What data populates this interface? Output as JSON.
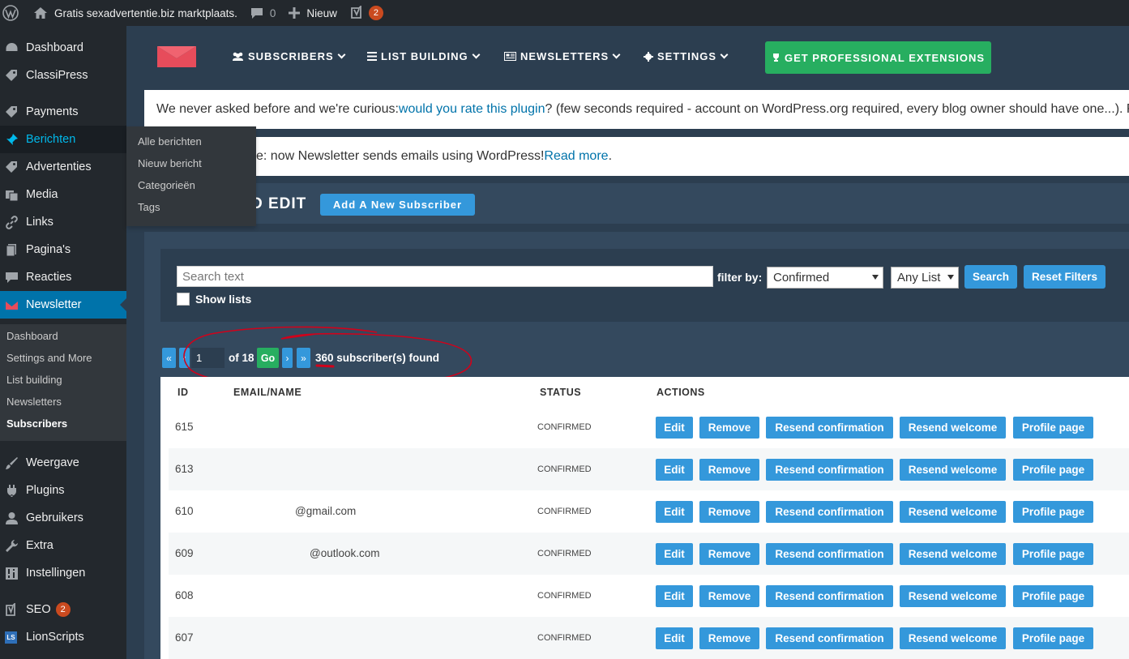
{
  "adminbar": {
    "site_name": "Gratis sexadvertentie.biz marktplaats.",
    "comments_count": "0",
    "new_label": "Nieuw",
    "seo_badge": "2"
  },
  "sidebar": {
    "items": [
      {
        "label": "Dashboard",
        "icon": "dashboard-icon"
      },
      {
        "label": "ClassiPress",
        "icon": "tag-icon"
      },
      {
        "label": "Payments",
        "icon": "tag-icon"
      },
      {
        "label": "Berichten",
        "icon": "pin-icon"
      },
      {
        "label": "Advertenties",
        "icon": "tag-icon"
      },
      {
        "label": "Media",
        "icon": "media-icon"
      },
      {
        "label": "Links",
        "icon": "link-icon"
      },
      {
        "label": "Pagina's",
        "icon": "page-icon"
      },
      {
        "label": "Reacties",
        "icon": "comment-icon"
      },
      {
        "label": "Newsletter",
        "icon": "newsletter-icon"
      },
      {
        "label": "Weergave",
        "icon": "brush-icon"
      },
      {
        "label": "Plugins",
        "icon": "plugin-icon"
      },
      {
        "label": "Gebruikers",
        "icon": "user-icon"
      },
      {
        "label": "Extra",
        "icon": "wrench-icon"
      },
      {
        "label": "Instellingen",
        "icon": "settings-icon"
      },
      {
        "label": "SEO",
        "icon": "yoast-icon",
        "badge": "2"
      },
      {
        "label": "LionScripts",
        "icon": "lionscripts-icon",
        "icon_text": "LS"
      }
    ],
    "newsletter_submenu": [
      "Dashboard",
      "Settings and More",
      "List building",
      "Newsletters",
      "Subscribers"
    ]
  },
  "flyout": [
    "Alle berichten",
    "Nieuw bericht",
    "Categorieën",
    "Tags"
  ],
  "plugin_nav": {
    "subscribers": "SUBSCRIBERS",
    "list_building": "LIST BUILDING",
    "newsletters": "NEWSLETTERS",
    "settings": "SETTINGS",
    "pro": "GET PROFESSIONAL EXTENSIONS"
  },
  "notices": {
    "rate_pre": "We never asked before and we're curious: ",
    "rate_link": "would you rate this plugin",
    "rate_post": "? (few seconds required - account on WordPress.org required, every blog owner should have one...). Re",
    "info_pre": "e: now Newsletter sends emails using WordPress! ",
    "info_link": "Read more",
    "info_post": "."
  },
  "section": {
    "title": "D EDIT",
    "add_button": "Add A New Subscriber"
  },
  "filters": {
    "search_placeholder": "Search text",
    "filter_by": "filter by:",
    "status_select": "Confirmed",
    "list_select": "Any List",
    "search_button": "Search",
    "reset_button": "Reset Filters",
    "show_lists": "Show lists"
  },
  "pagination": {
    "first": "«",
    "prev": "‹",
    "page": "1",
    "of": "of 18",
    "go": "Go",
    "next": "›",
    "last": "»",
    "found": "360 subscriber(s) found"
  },
  "table": {
    "headers": {
      "id": "ID",
      "email": "EMAIL/NAME",
      "status": "STATUS",
      "actions": "ACTIONS"
    },
    "actions": {
      "edit": "Edit",
      "remove": "Remove",
      "resend_confirmation": "Resend confirmation",
      "resend_welcome": "Resend welcome",
      "profile": "Profile page"
    },
    "rows": [
      {
        "id": "615",
        "email": "",
        "status": "CONFIRMED"
      },
      {
        "id": "613",
        "email": "",
        "status": "CONFIRMED"
      },
      {
        "id": "610",
        "email": "@gmail.com",
        "status": "CONFIRMED"
      },
      {
        "id": "609",
        "email": "@outlook.com",
        "status": "CONFIRMED"
      },
      {
        "id": "608",
        "email": "",
        "status": "CONFIRMED"
      },
      {
        "id": "607",
        "email": "",
        "status": "CONFIRMED"
      }
    ]
  },
  "colors": {
    "wp_dark": "#23282d",
    "wp_blue": "#0073aa",
    "plugin_bg": "#2c3e50",
    "plugin_panel": "#34495e",
    "button_blue": "#3498db",
    "button_green": "#27ae60",
    "annotation_red": "#d0021b"
  }
}
